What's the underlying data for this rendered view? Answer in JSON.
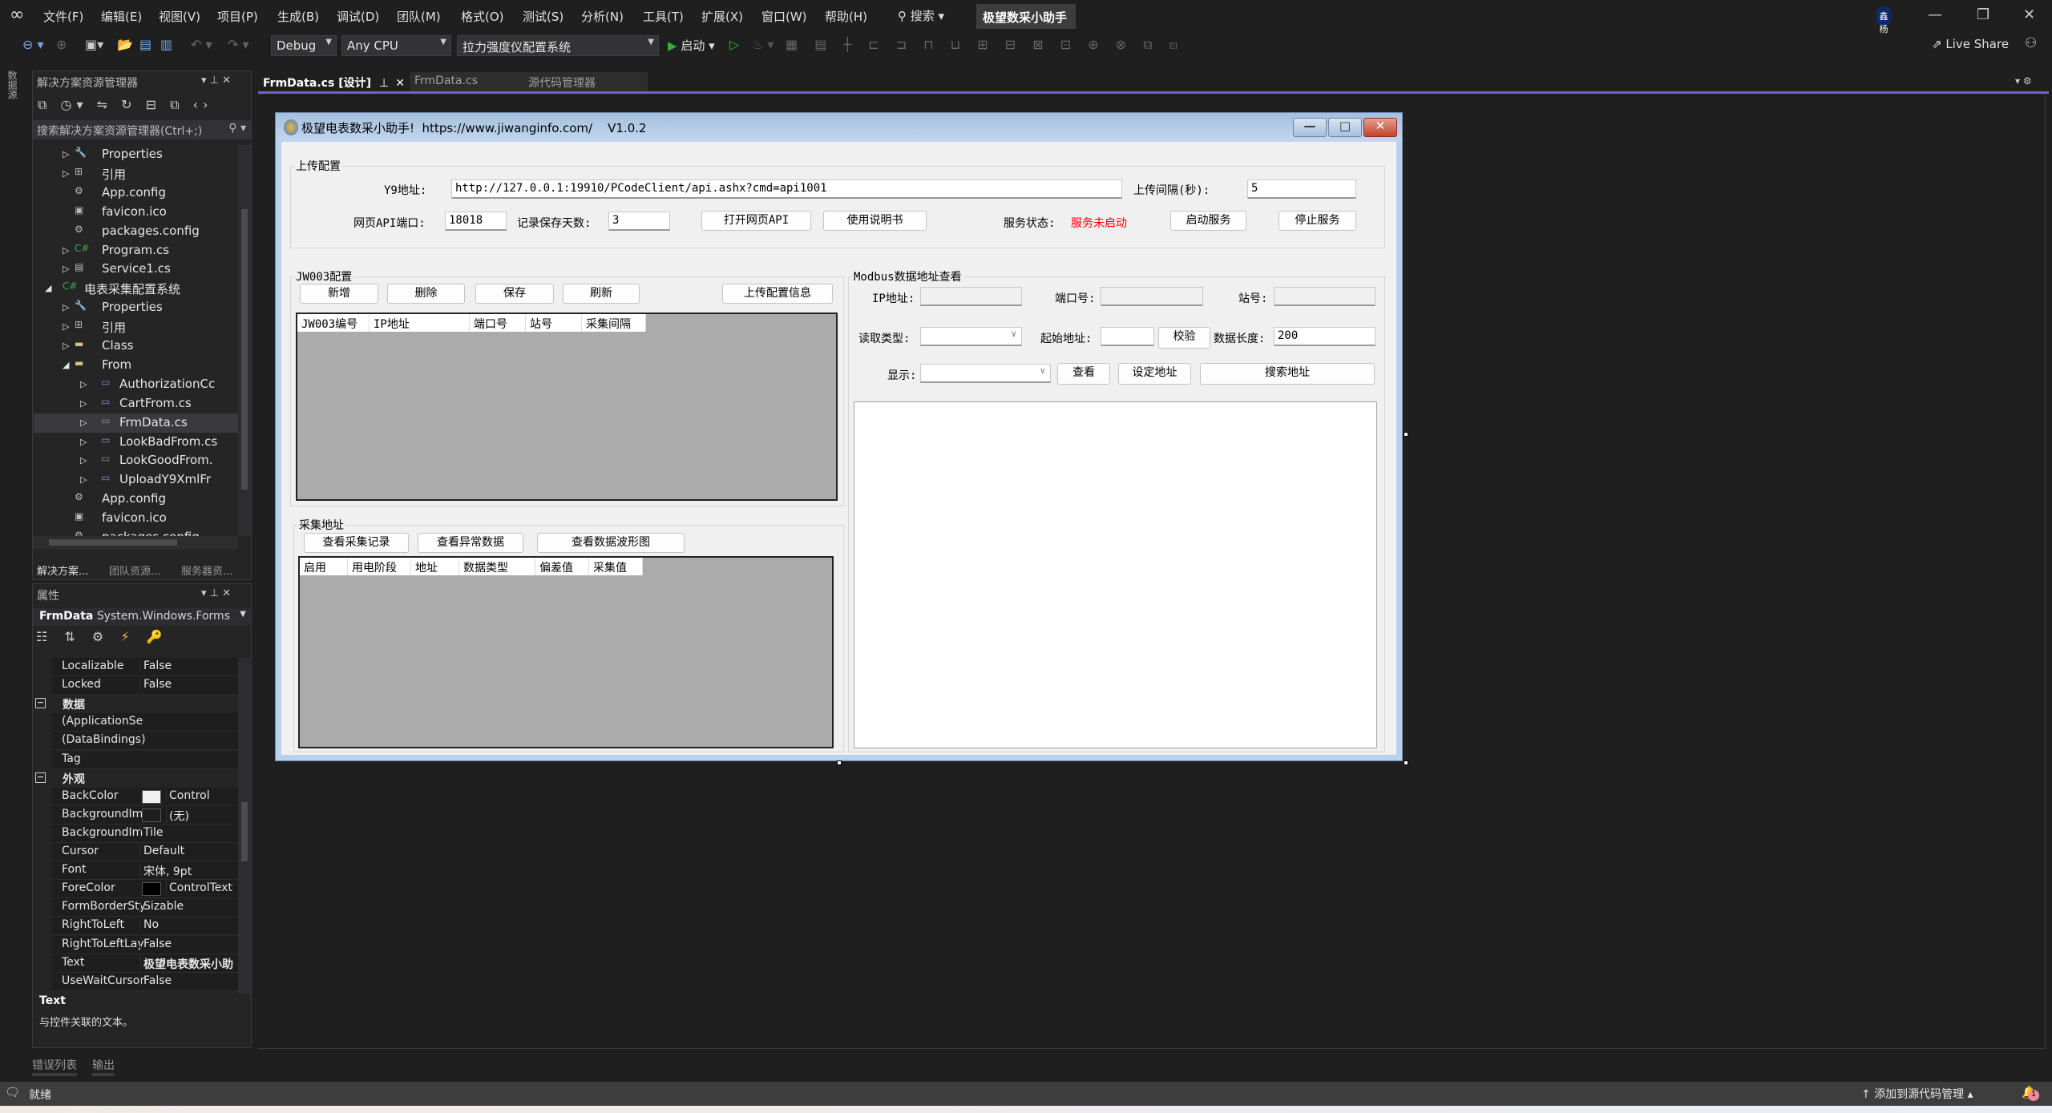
{
  "menu": {
    "items": [
      "文件(F)",
      "编辑(E)",
      "视图(V)",
      "项目(P)",
      "生成(B)",
      "调试(D)",
      "团队(M)",
      "格式(O)",
      "测试(S)",
      "分析(N)",
      "工具(T)",
      "扩展(X)",
      "窗口(W)",
      "帮助(H)"
    ],
    "search": "搜索",
    "solution_title": "极望数采小助手",
    "user_badge": "鑫杨"
  },
  "toolbar": {
    "config": "Debug",
    "platform": "Any CPU",
    "startup_project": "拉力强度仪配置系统",
    "start": "启动",
    "live_share": "Live Share"
  },
  "left_strip": {
    "label": "数据源"
  },
  "tabs": [
    {
      "label": "FrmData.cs [设计]",
      "active": true
    },
    {
      "label": "FrmData.cs",
      "active": false
    },
    {
      "label": "源代码管理器",
      "active": false
    }
  ],
  "solution_explorer": {
    "title": "解决方案资源管理器",
    "search_placeholder": "搜索解决方案资源管理器(Ctrl+;)",
    "items": [
      {
        "label": "Properties",
        "icon": "wrench",
        "level": 1,
        "arrow": "collapsed"
      },
      {
        "label": "引用",
        "icon": "references",
        "level": 1,
        "arrow": "collapsed"
      },
      {
        "label": "App.config",
        "icon": "config",
        "level": 1,
        "arrow": ""
      },
      {
        "label": "favicon.ico",
        "icon": "image",
        "level": 1,
        "arrow": ""
      },
      {
        "label": "packages.config",
        "icon": "config",
        "level": 1,
        "arrow": ""
      },
      {
        "label": "Program.cs",
        "icon": "csharp",
        "level": 1,
        "arrow": "collapsed"
      },
      {
        "label": "Service1.cs",
        "icon": "service",
        "level": 1,
        "arrow": "collapsed"
      },
      {
        "label": "电表采集配置系统",
        "icon": "csproj",
        "level": 0,
        "arrow": "expanded"
      },
      {
        "label": "Properties",
        "icon": "wrench",
        "level": 1,
        "arrow": "collapsed"
      },
      {
        "label": "引用",
        "icon": "references",
        "level": 1,
        "arrow": "collapsed"
      },
      {
        "label": "Class",
        "icon": "folder",
        "level": 1,
        "arrow": "collapsed"
      },
      {
        "label": "From",
        "icon": "folder",
        "level": 1,
        "arrow": "expanded"
      },
      {
        "label": "AuthorizationCc",
        "icon": "form",
        "level": 2,
        "arrow": "collapsed"
      },
      {
        "label": "CartFrom.cs",
        "icon": "form",
        "level": 2,
        "arrow": "collapsed"
      },
      {
        "label": "FrmData.cs",
        "icon": "form",
        "level": 2,
        "arrow": "collapsed",
        "selected": true
      },
      {
        "label": "LookBadFrom.cs",
        "icon": "form",
        "level": 2,
        "arrow": "collapsed"
      },
      {
        "label": "LookGoodFrom.",
        "icon": "form",
        "level": 2,
        "arrow": "collapsed"
      },
      {
        "label": "UploadY9XmlFr",
        "icon": "form",
        "level": 2,
        "arrow": "collapsed"
      },
      {
        "label": "App.config",
        "icon": "config",
        "level": 1,
        "arrow": ""
      },
      {
        "label": "favicon.ico",
        "icon": "image",
        "level": 1,
        "arrow": ""
      },
      {
        "label": "packages.config",
        "icon": "config",
        "level": 1,
        "arrow": ""
      }
    ],
    "bottom_tabs": [
      "解决方案...",
      "团队资源...",
      "服务器资..."
    ]
  },
  "properties": {
    "title": "属性",
    "object_name": "FrmData",
    "object_type": "System.Windows.Forms",
    "rows": [
      {
        "name": "Localizable",
        "value": "False"
      },
      {
        "name": "Locked",
        "value": "False"
      },
      {
        "name": "数据",
        "category": true,
        "expander": "−"
      },
      {
        "name": "(ApplicationSe",
        "value": "",
        "expander": "+"
      },
      {
        "name": "(DataBindings)",
        "value": "",
        "expander": "+"
      },
      {
        "name": "Tag",
        "value": ""
      },
      {
        "name": "外观",
        "category": true,
        "expander": "−"
      },
      {
        "name": "BackColor",
        "value": "Control",
        "swatch": "#f0f0f0"
      },
      {
        "name": "BackgroundIm",
        "value": "(无)",
        "swatch": "#1e1e1e"
      },
      {
        "name": "BackgroundIm",
        "value": "Tile"
      },
      {
        "name": "Cursor",
        "value": "Default"
      },
      {
        "name": "Font",
        "value": "宋体, 9pt",
        "expander": "+"
      },
      {
        "name": "ForeColor",
        "value": "ControlText",
        "swatch": "#000000"
      },
      {
        "name": "FormBorderSty",
        "value": "Sizable"
      },
      {
        "name": "RightToLeft",
        "value": "No"
      },
      {
        "name": "RightToLeftLay",
        "value": "False"
      },
      {
        "name": "Text",
        "value": "极望电表数采小助",
        "bold": true
      },
      {
        "name": "UseWaitCursor",
        "value": "False"
      }
    ],
    "desc_title": "Text",
    "desc_text": "与控件关联的文本。"
  },
  "bottom_tabs": [
    "错误列表",
    "输出"
  ],
  "status": {
    "ready": "就绪",
    "source_control": "添加到源代码管理",
    "notifications": "1"
  },
  "form": {
    "title": "极望电表数采小助手!  https://www.jiwanginfo.com/    V1.0.2",
    "upload": {
      "group": "上传配置",
      "y9_label": "Y9地址:",
      "y9_value": "http://127.0.0.1:19910/PCodeClient/api.ashx?cmd=api1001",
      "interval_label": "上传间隔(秒):",
      "interval_value": "5",
      "port_label": "网页API端口:",
      "port_value": "18018",
      "days_label": "记录保存天数:",
      "days_value": "3",
      "open_api": "打开网页API",
      "manual": "使用说明书",
      "status_label": "服务状态:",
      "status_value": "服务未启动",
      "status_color": "#ff0000",
      "start": "启动服务",
      "stop": "停止服务"
    },
    "jw003": {
      "group": "JW003配置",
      "buttons": [
        "新增",
        "删除",
        "保存",
        "刷新"
      ],
      "upload_info": "上传配置信息",
      "columns": [
        "JW003编号",
        "IP地址",
        "端口号",
        "站号",
        "采集间隔"
      ]
    },
    "collect": {
      "group": "采集地址",
      "buttons": [
        "查看采集记录",
        "查看异常数据",
        "查看数据波形图"
      ],
      "columns": [
        "启用",
        "用电阶段",
        "地址",
        "数据类型",
        "偏差值",
        "采集值"
      ]
    },
    "modbus": {
      "group": "Modbus数据地址查看",
      "ip_label": "IP地址:",
      "port_label": "端口号:",
      "station_label": "站号:",
      "read_type_label": "读取类型:",
      "start_addr_label": "起始地址:",
      "verify": "校验",
      "length_label": "数据长度:",
      "length_value": "200",
      "display_label": "显示:",
      "view": "查看",
      "set_addr": "设定地址",
      "search_addr": "搜索地址"
    }
  }
}
